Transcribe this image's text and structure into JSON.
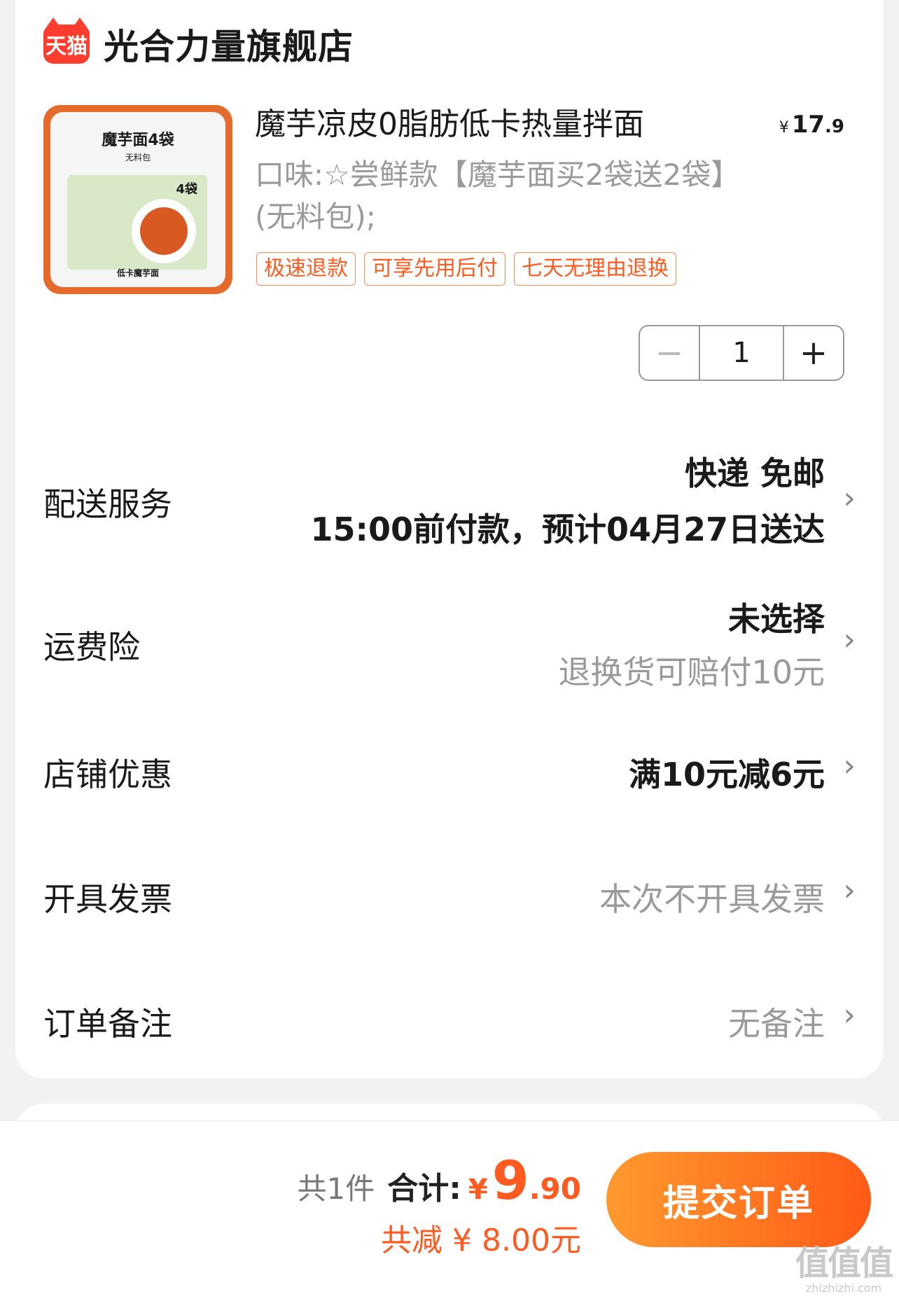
{
  "shop": {
    "logo_text": "天猫",
    "name": "光合力量旗舰店"
  },
  "product": {
    "thumb": {
      "title": "魔芋面4袋",
      "subtitle": "无料包",
      "bags": "4袋",
      "footer": "低卡魔芋面"
    },
    "title": "魔芋凉皮0脂肪低卡热量拌面",
    "price_symbol": "¥",
    "price_int": "17",
    "price_dec": ".9",
    "spec": "口味:☆尝鲜款【魔芋面买2袋送2袋】(无料包);",
    "tags": [
      "极速退款",
      "可享先用后付",
      "七天无理由退换"
    ],
    "quantity": "1"
  },
  "rows": {
    "delivery": {
      "label": "配送服务",
      "line1": "快递 免邮",
      "line2": "15:00前付款，预计04月27日送达"
    },
    "insurance": {
      "label": "运费险",
      "line1": "未选择",
      "line2": "退换货可赔付10元"
    },
    "coupon": {
      "label": "店铺优惠",
      "value": "满10元减6元"
    },
    "invoice": {
      "label": "开具发票",
      "value": "本次不开具发票"
    },
    "remark": {
      "label": "订单备注",
      "value": "无备注"
    }
  },
  "footer": {
    "count": "共1件",
    "total_label": "合计:",
    "total_symbol": "¥",
    "total_int": "9",
    "total_dec": ".90",
    "discount": "共减 ¥ 8.00元",
    "submit_label": "提交订单"
  },
  "watermark": {
    "big": "值值值",
    "small": "zhizhizhi.com"
  },
  "colors": {
    "accent": "#ff5a1f",
    "tmall_red": "#ff3d2e"
  },
  "icons": {
    "chevron": "chevron-right-icon",
    "minus": "minus-icon",
    "plus": "plus-icon"
  }
}
